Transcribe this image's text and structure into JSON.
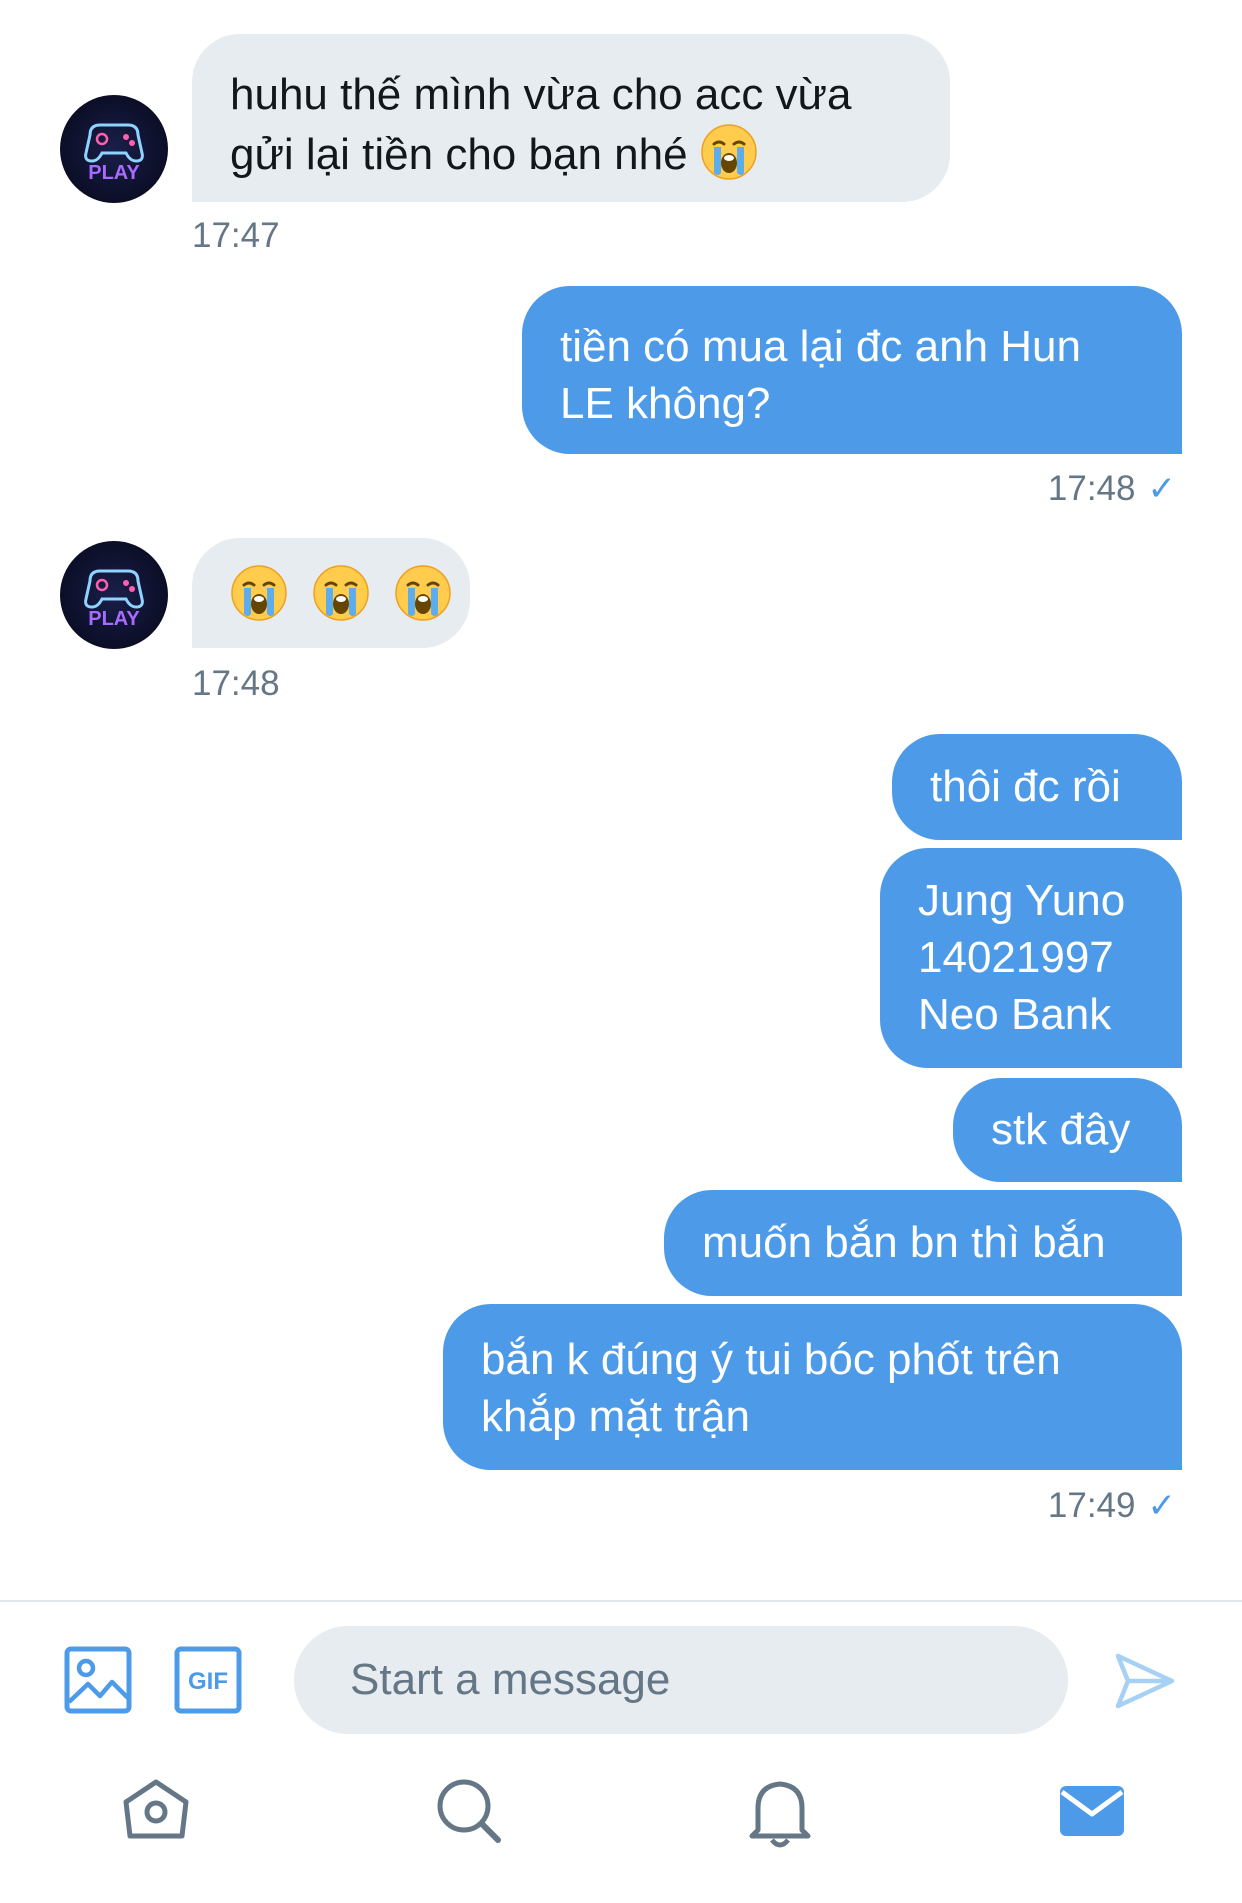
{
  "messages": [
    {
      "type": "in",
      "lines": [
        "huhu thế mình vừa cho acc vừa",
        "gửi lại tiền cho bạn nhé"
      ],
      "emoji_count": 1,
      "time": "17:47"
    },
    {
      "type": "out",
      "lines": [
        "tiền có mua lại đc anh Hun",
        "LE không?"
      ],
      "time": "17:48"
    },
    {
      "type": "in",
      "lines": [],
      "emoji_count": 3,
      "time": "17:48"
    },
    {
      "type": "out",
      "lines": [
        "thôi đc rồi"
      ]
    },
    {
      "type": "out",
      "lines": [
        "Jung Yuno",
        "14021997",
        "Neo Bank"
      ]
    },
    {
      "type": "out",
      "lines": [
        "stk đây"
      ]
    },
    {
      "type": "out",
      "lines": [
        "muốn bắn bn thì bắn"
      ]
    },
    {
      "type": "out",
      "lines": [
        "bắn k đúng ý tui bóc phốt trên",
        "khắp mặt trận"
      ],
      "time": "17:49"
    }
  ],
  "avatar": {
    "badge_text": "PLAY"
  },
  "emoji_icon": "loudly-crying-face-icon",
  "composer": {
    "placeholder": "Start a message",
    "gif_label": "GIF"
  },
  "colors": {
    "accent": "#4d9be8",
    "incoming_bubble": "#e6ecf0",
    "muted_text": "#657786"
  }
}
